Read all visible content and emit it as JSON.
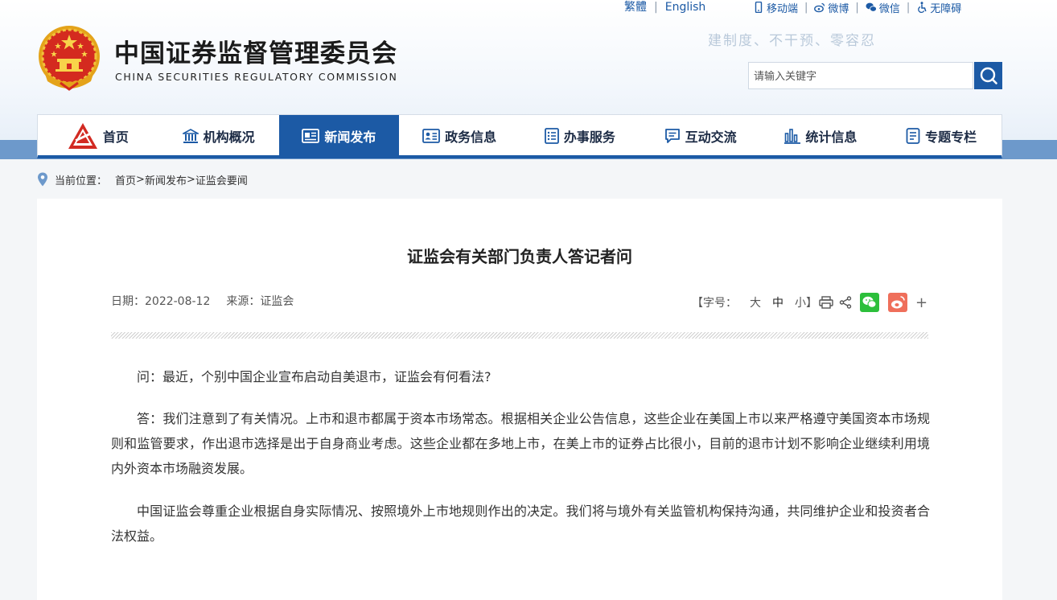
{
  "top_bar": {
    "traditional": "繁體",
    "english": "English",
    "mobile": "移动端",
    "weibo": "微博",
    "wechat": "微信",
    "accessibility": "无障碍"
  },
  "header": {
    "org_name_cn": "中国证券监督管理委员会",
    "org_name_en": "CHINA SECURITIES REGULATORY COMMISSION",
    "slogan": "建制度、不干预、零容忍"
  },
  "search": {
    "placeholder": "请输入关键字"
  },
  "nav": {
    "items": [
      {
        "label": "首页",
        "icon": "csrc-logo-icon"
      },
      {
        "label": "机构概况",
        "icon": "building-icon"
      },
      {
        "label": "新闻发布",
        "icon": "newspaper-icon",
        "active": true
      },
      {
        "label": "政务信息",
        "icon": "id-card-icon"
      },
      {
        "label": "办事服务",
        "icon": "service-list-icon"
      },
      {
        "label": "互动交流",
        "icon": "chat-icon"
      },
      {
        "label": "统计信息",
        "icon": "bar-chart-icon"
      },
      {
        "label": "专题专栏",
        "icon": "document-icon"
      }
    ],
    "accent_color": "#1c5aa5"
  },
  "breadcrumb": {
    "prefix": "当前位置：",
    "home": "首页",
    "sep1": ">",
    "section": "新闻发布",
    "sep2": ">",
    "current": "证监会要闻"
  },
  "article": {
    "title": "证监会有关部门负责人答记者问",
    "date": "日期：2022-08-12",
    "source": "来源：证监会",
    "font_size_label": "【字号：",
    "font_large": "大",
    "font_medium": "中",
    "font_small": "小】",
    "more": "+",
    "paragraphs": [
      "问：最近，个别中国企业宣布启动自美退市，证监会有何看法?",
      "答：我们注意到了有关情况。上市和退市都属于资本市场常态。根据相关企业公告信息，这些企业在美国上市以来严格遵守美国资本市场规则和监管要求，作出退市选择是出于自身商业考虑。这些企业都在多地上市，在美上市的证券占比很小，目前的退市计划不影响企业继续利用境内外资本市场融资发展。",
      "中国证监会尊重企业根据自身实际情况、按照境外上市地规则作出的决定。我们将与境外有关监管机构保持沟通，共同维护企业和投资者合法权益。"
    ]
  }
}
